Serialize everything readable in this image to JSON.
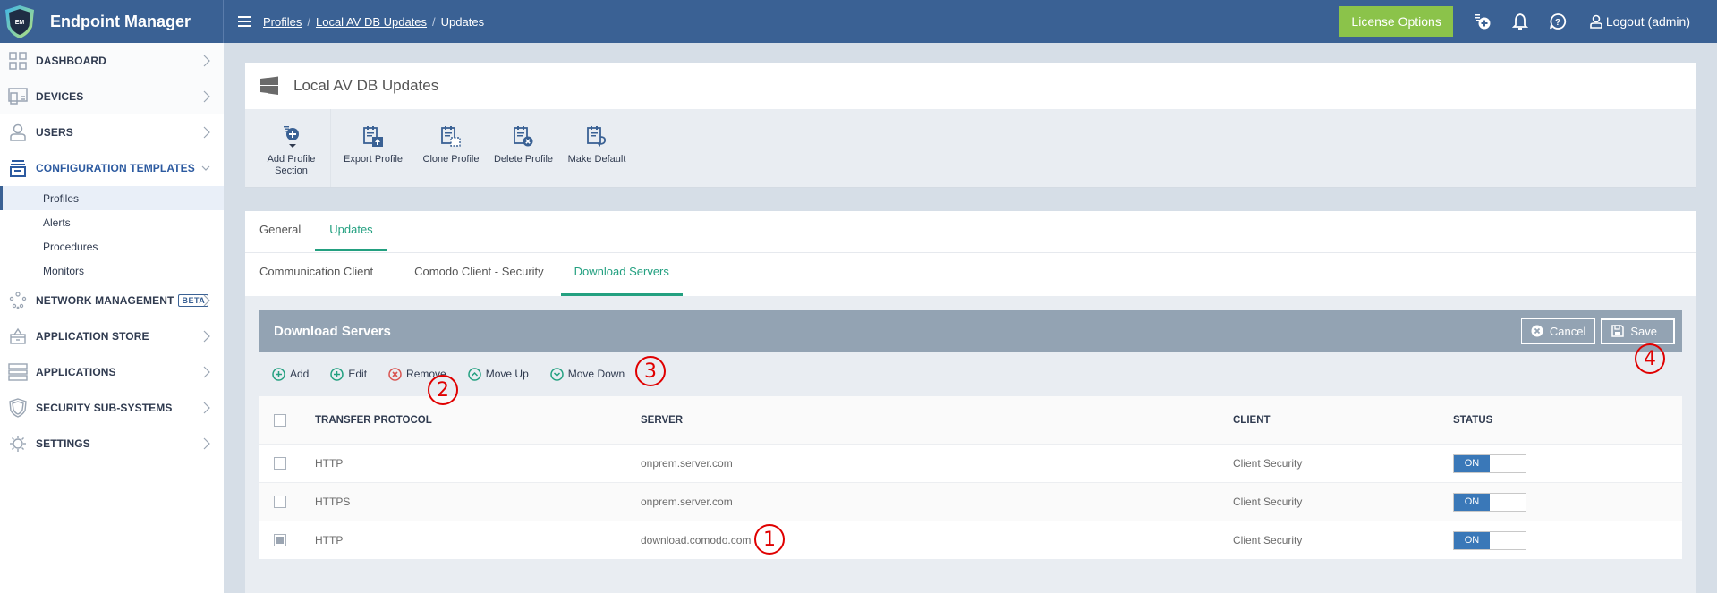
{
  "app": {
    "title": "Endpoint Manager",
    "logo_text": "EM"
  },
  "breadcrumb": {
    "items": [
      "Profiles",
      "Local AV DB Updates",
      "Updates"
    ],
    "separator": "/"
  },
  "topbar": {
    "license_button": "License Options",
    "icons": [
      "add-profile-icon",
      "bell-icon",
      "help-icon"
    ],
    "logout_label": "Logout (admin)"
  },
  "sidebar": {
    "items": [
      {
        "label": "DASHBOARD",
        "icon": "dashboard-icon"
      },
      {
        "label": "DEVICES",
        "icon": "devices-icon"
      },
      {
        "label": "USERS",
        "icon": "user-icon"
      },
      {
        "label": "CONFIGURATION TEMPLATES",
        "icon": "configuration-icon",
        "expanded": true,
        "children": [
          {
            "label": "Profiles",
            "selected": true
          },
          {
            "label": "Alerts"
          },
          {
            "label": "Procedures"
          },
          {
            "label": "Monitors"
          }
        ]
      },
      {
        "label": "NETWORK MANAGEMENT",
        "icon": "network-icon",
        "badge": "BETA"
      },
      {
        "label": "APPLICATION STORE",
        "icon": "basket-icon"
      },
      {
        "label": "APPLICATIONS",
        "icon": "applications-icon"
      },
      {
        "label": "SECURITY SUB-SYSTEMS",
        "icon": "shield-icon"
      },
      {
        "label": "SETTINGS",
        "icon": "gear-icon"
      }
    ]
  },
  "profile": {
    "title": "Local AV DB Updates",
    "os_icon": "windows-icon",
    "toolbar": [
      {
        "label": "Add Profile Section",
        "line1": "Add Profile",
        "line2": "Section"
      },
      {
        "label": "Export Profile"
      },
      {
        "label": "Clone Profile"
      },
      {
        "label": "Delete Profile"
      },
      {
        "label": "Make Default"
      }
    ]
  },
  "tabs": {
    "items": [
      "General",
      "Updates"
    ],
    "active": "Updates"
  },
  "subtabs": {
    "items": [
      "Communication Client",
      "Comodo Client - Security",
      "Download Servers"
    ],
    "active": "Download Servers"
  },
  "section": {
    "title": "Download Servers",
    "cancel_label": "Cancel",
    "save_label": "Save",
    "actions": [
      "Add",
      "Edit",
      "Remove",
      "Move Up",
      "Move Down"
    ]
  },
  "table": {
    "columns": [
      "TRANSFER PROTOCOL",
      "SERVER",
      "CLIENT",
      "STATUS"
    ],
    "rows": [
      {
        "checked": false,
        "protocol": "HTTP",
        "server": "onprem.server.com",
        "client": "Client Security",
        "status": "ON"
      },
      {
        "checked": false,
        "protocol": "HTTPS",
        "server": "onprem.server.com",
        "client": "Client Security",
        "status": "ON"
      },
      {
        "checked": true,
        "protocol": "HTTP",
        "server": "download.comodo.com",
        "client": "Client Security",
        "status": "ON"
      }
    ]
  },
  "annotations": [
    "1",
    "2",
    "3",
    "4"
  ],
  "colors": {
    "topbar": "#3a6194",
    "accent_green": "#23a080",
    "license_green": "#8bc34a",
    "toggle_on": "#3a78b8",
    "section_header": "#93a3b3",
    "annotation_red": "#e00000"
  }
}
